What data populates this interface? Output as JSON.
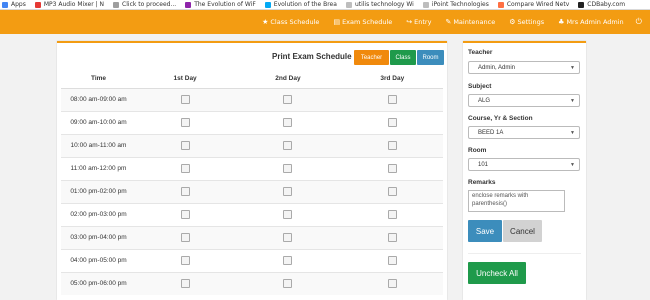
{
  "bookmarks": [
    {
      "label": "Apps",
      "color": "#4285f4"
    },
    {
      "label": "MP3 Audio Mixer | N",
      "color": "#e53935"
    },
    {
      "label": "Click to proceed...",
      "color": "#9e9e9e"
    },
    {
      "label": "The Evolution of WiF",
      "color": "#8e24aa"
    },
    {
      "label": "Evolution of the Brea",
      "color": "#03a9f4"
    },
    {
      "label": "utilis technology Wi",
      "color": "#bdbdbd"
    },
    {
      "label": "iPoint Technologies",
      "color": "#bdbdbd"
    },
    {
      "label": "Compare Wired Netv",
      "color": "#ff7043"
    },
    {
      "label": "CDBaby.com",
      "color": "#212121"
    }
  ],
  "nav": {
    "items": [
      {
        "icon": "★",
        "label": "Class Schedule"
      },
      {
        "icon": "▤",
        "label": "Exam Schedule"
      },
      {
        "icon": "↪",
        "label": "Entry"
      },
      {
        "icon": "✎",
        "label": "Maintenance"
      },
      {
        "icon": "⚙",
        "label": "Settings"
      },
      {
        "icon": "♣",
        "label": "Mrs Admin Admin"
      }
    ],
    "power_icon": "⏻"
  },
  "main": {
    "title": "Print Exam Schedule",
    "buttons": {
      "teacher": "Teacher",
      "class": "Class",
      "room": "Room"
    },
    "columns": [
      "Time",
      "1st Day",
      "2nd Day",
      "3rd Day"
    ],
    "rows": [
      "08:00 am-09:00 am",
      "09:00 am-10:00 am",
      "10:00 am-11:00 am",
      "11:00 am-12:00 pm",
      "01:00 pm-02:00 pm",
      "02:00 pm-03:00 pm",
      "03:00 pm-04:00 pm",
      "04:00 pm-05:00 pm",
      "05:00 pm-06:00 pm"
    ]
  },
  "side": {
    "teacher_label": "Teacher",
    "teacher_value": "Admin, Admin",
    "subject_label": "Subject",
    "subject_value": "ALG",
    "course_label": "Course, Yr & Section",
    "course_value": "BEED 1A",
    "room_label": "Room",
    "room_value": "101",
    "remarks_label": "Remarks",
    "remarks_placeholder": "enclose remarks with parenthesis()",
    "save": "Save",
    "cancel": "Cancel",
    "uncheck_all": "Uncheck All"
  },
  "colors": {
    "accent": "#f39c12",
    "primary": "#3c8dbc",
    "success": "#1f9a4b"
  }
}
